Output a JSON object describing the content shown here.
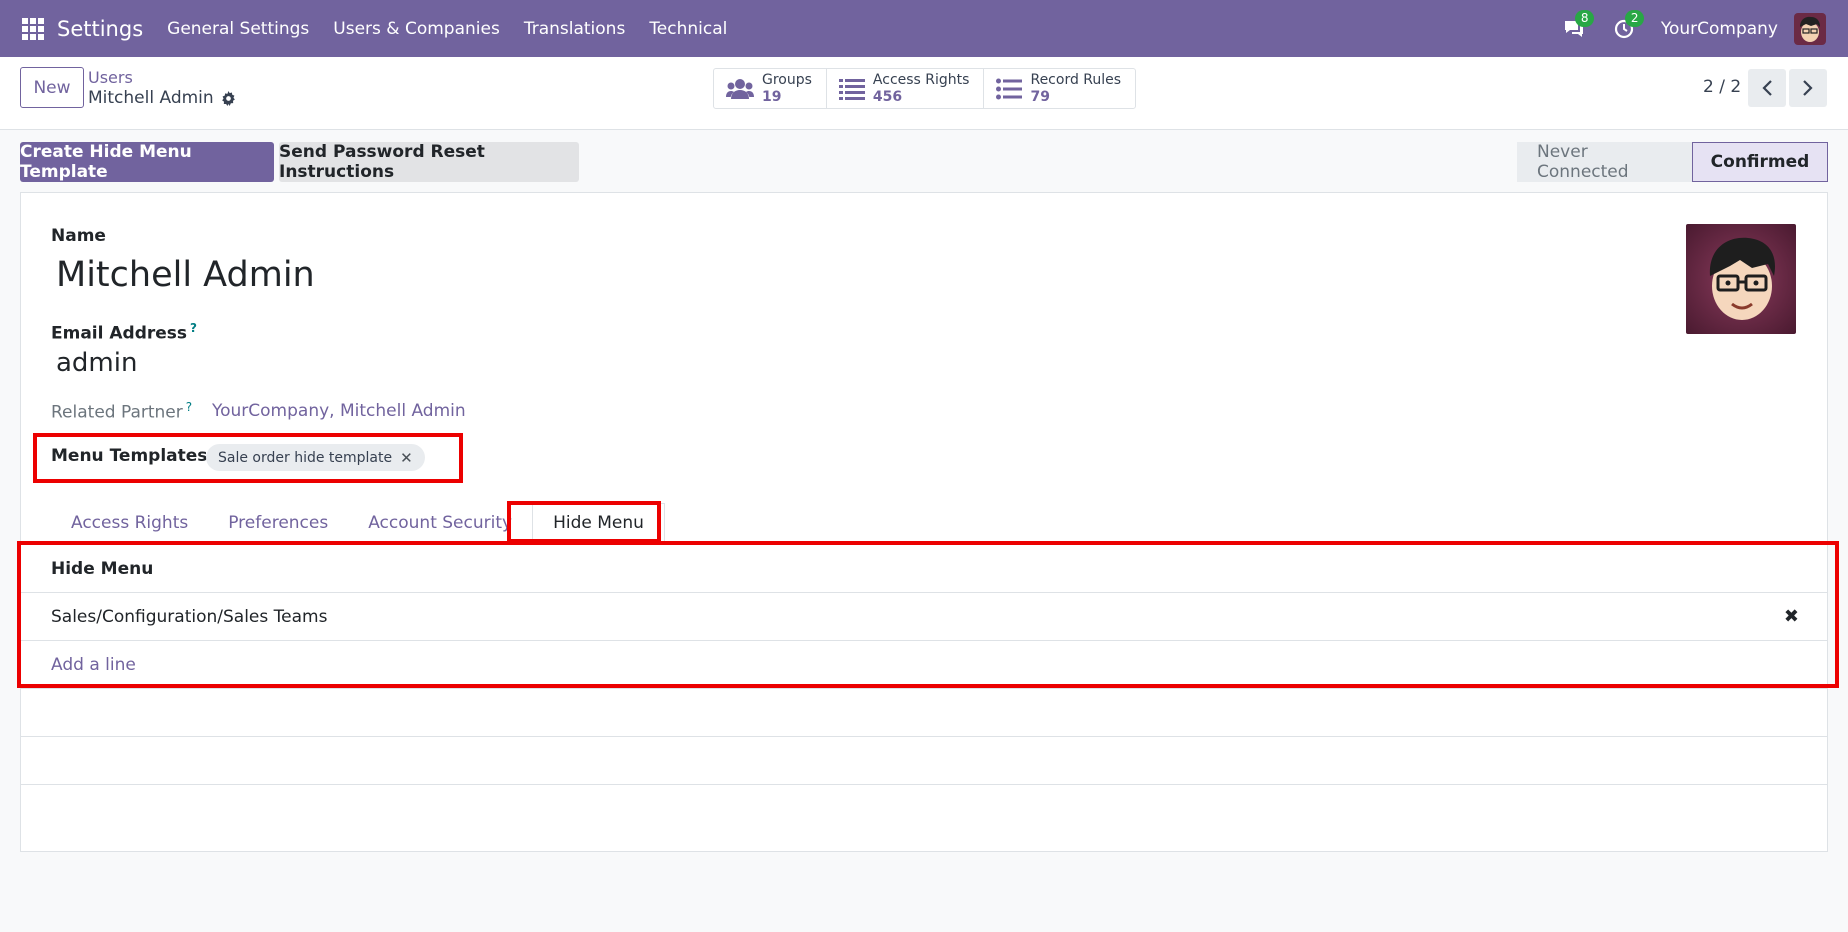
{
  "navbar": {
    "app_name": "Settings",
    "menus": [
      "General Settings",
      "Users & Companies",
      "Translations",
      "Technical"
    ],
    "messages_badge": "8",
    "activities_badge": "2",
    "company": "YourCompany",
    "bg_color": "#71639e"
  },
  "control_panel": {
    "new_label": "New",
    "breadcrumb_parent": "Users",
    "breadcrumb_current": "Mitchell Admin",
    "stats": [
      {
        "label": "Groups",
        "value": "19",
        "icon": "users-icon"
      },
      {
        "label": "Access Rights",
        "value": "456",
        "icon": "list-icon"
      },
      {
        "label": "Record Rules",
        "value": "79",
        "icon": "list-icon"
      }
    ],
    "pager": "2 / 2"
  },
  "actions": {
    "primary": "Create Hide Menu Template",
    "secondary": "Send Password Reset Instructions"
  },
  "statusbar": {
    "states": [
      "Never Connected",
      "Confirmed"
    ],
    "current": "Confirmed"
  },
  "form": {
    "name_label": "Name",
    "name_value": "Mitchell Admin",
    "email_label": "Email Address",
    "email_help": "?",
    "email_value": "admin",
    "partner_label": "Related Partner",
    "partner_help": "?",
    "partner_value": "YourCompany, Mitchell Admin",
    "menu_templates_label": "Menu Templates",
    "menu_templates_tags": [
      "Sale order hide template"
    ]
  },
  "tabs": [
    {
      "label": "Access Rights",
      "active": false
    },
    {
      "label": "Preferences",
      "active": false
    },
    {
      "label": "Account Security",
      "active": false
    },
    {
      "label": "Hide Menu",
      "active": true
    }
  ],
  "hide_menu_table": {
    "header": "Hide Menu",
    "rows": [
      "Sales/Configuration/Sales Teams"
    ],
    "remove_glyph": "✖",
    "add_line": "Add a line"
  }
}
